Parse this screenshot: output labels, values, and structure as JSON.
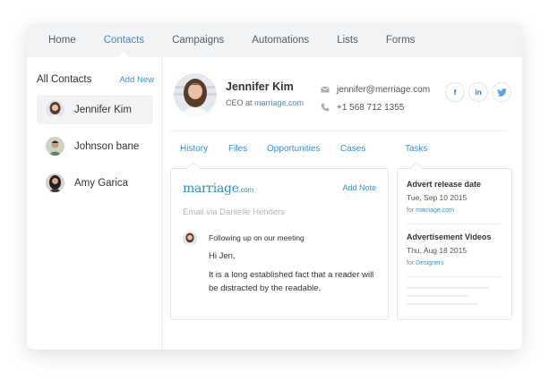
{
  "nav": {
    "items": [
      {
        "label": "Home"
      },
      {
        "label": "Contacts"
      },
      {
        "label": "Campaigns"
      },
      {
        "label": "Automations"
      },
      {
        "label": "Lists"
      },
      {
        "label": "Forms"
      }
    ],
    "active": "Contacts"
  },
  "sidebar": {
    "title": "All Contacts",
    "add_label": "Add New",
    "contacts": [
      {
        "name": "Jennifer Kim"
      },
      {
        "name": "Johnson bane"
      },
      {
        "name": "Amy Garica"
      }
    ]
  },
  "profile": {
    "name": "Jennifer Kim",
    "title_prefix": "CEO at",
    "company": "marriage.com",
    "email": "jennifer@merriage.com",
    "phone": "+1 568 712 1355",
    "socials": [
      {
        "label": "f",
        "icon": "facebook-icon"
      },
      {
        "label": "in",
        "icon": "linkedin-icon"
      },
      {
        "label": "t",
        "icon": "twitter-icon"
      }
    ]
  },
  "tabs": [
    {
      "label": "History"
    },
    {
      "label": "Files"
    },
    {
      "label": "Opportunities"
    },
    {
      "label": "Cases"
    },
    {
      "label": "Tasks"
    }
  ],
  "history": {
    "brand_main": "marriage",
    "brand_suffix": ".com",
    "add_note_label": "Add Note",
    "email_via": "Email via Danielle Henders",
    "subject": "Following up on our meeting",
    "greeting": "Hi Jen,",
    "body": "It is a long established fact that a reader will be distracted by the readable."
  },
  "tasks": [
    {
      "title": "Advert release date",
      "date": "Tue, Sep 10 2015",
      "meta_prefix": "for",
      "meta_link": "marriage.com"
    },
    {
      "title": "Advertisement Videos",
      "date": "Thu, Aug 18 2015",
      "meta_prefix": "for",
      "meta_link": "Designers"
    }
  ],
  "colors": {
    "accent": "#3a8fd9",
    "nav_bg": "#f1f3f5",
    "brand": "#2f8fc9"
  }
}
